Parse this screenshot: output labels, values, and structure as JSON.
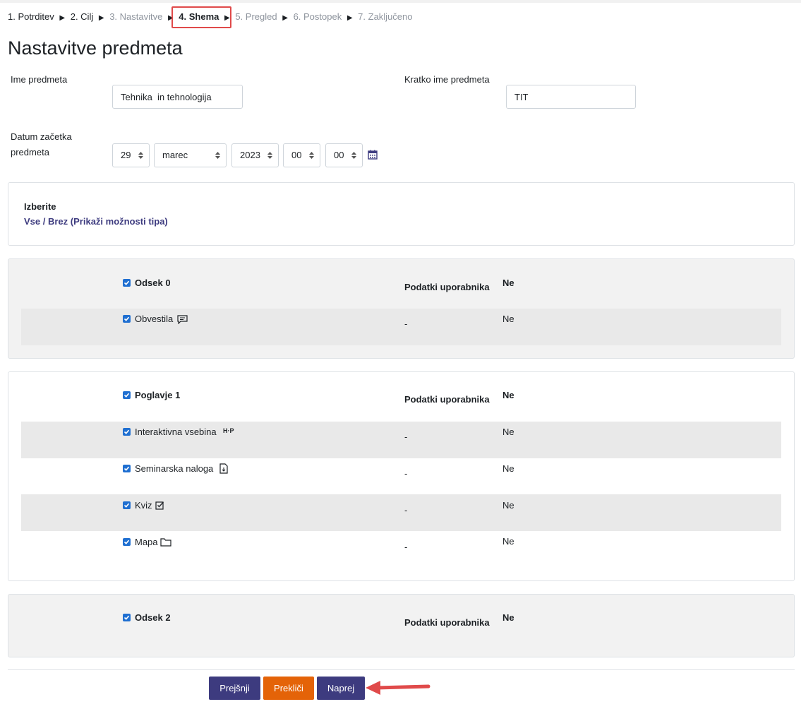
{
  "steps": [
    {
      "label": "1. Potrditev",
      "state": "done"
    },
    {
      "label": "2. Cilj",
      "state": "done"
    },
    {
      "label": "3. Nastavitve",
      "state": "future"
    },
    {
      "label": "4. Shema",
      "state": "current"
    },
    {
      "label": "5. Pregled",
      "state": "future"
    },
    {
      "label": "6. Postopek",
      "state": "future"
    },
    {
      "label": "7. Zaključeno",
      "state": "future"
    }
  ],
  "step_separator": "▶",
  "page_title": "Nastavitve predmeta",
  "form": {
    "fullname_label": "Ime predmeta",
    "fullname_value": "Tehnika  in tehnologija",
    "shortname_label": "Kratko ime predmeta",
    "shortname_value": "TIT",
    "startdate_label_line1": "Datum začetka",
    "startdate_label_line2": "predmeta",
    "day": "29",
    "month": "marec",
    "year": "2023",
    "hour": "00",
    "minute": "00"
  },
  "select_box": {
    "title": "Izberite",
    "all": "Vse",
    "slash": " / ",
    "none": "Brez",
    "show_type_options": "(Prikaži možnosti tipa)"
  },
  "column_header": "Podatki uporabnika",
  "sections": [
    {
      "name": "Odsek 0",
      "value": "Ne",
      "activities": [
        {
          "name": "Obvestila",
          "icon": "forum-icon",
          "data": "-",
          "value": "Ne"
        }
      ]
    },
    {
      "name": "Poglavje 1",
      "value": "Ne",
      "activities": [
        {
          "name": "Interaktivna vsebina",
          "icon": "h5p-icon",
          "icon_text": "H·P",
          "data": "-",
          "value": "Ne"
        },
        {
          "name": "Seminarska naloga",
          "icon": "assignment-icon",
          "data": "-",
          "value": "Ne"
        },
        {
          "name": "Kviz",
          "icon": "quiz-icon",
          "data": "-",
          "value": "Ne"
        },
        {
          "name": "Mapa",
          "icon": "folder-icon",
          "data": "-",
          "value": "Ne"
        }
      ]
    },
    {
      "name": "Odsek 2",
      "value": "Ne",
      "activities": []
    }
  ],
  "buttons": {
    "previous": "Prejšnji",
    "cancel": "Prekliči",
    "next": "Naprej"
  },
  "colors": {
    "primary": "#3d3b7f",
    "danger": "#e46308",
    "checkbox": "#1f6fd1",
    "annotation": "#e04a4a"
  }
}
